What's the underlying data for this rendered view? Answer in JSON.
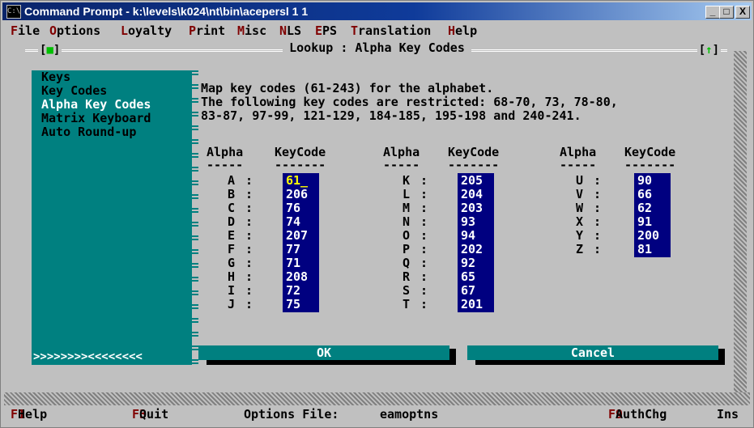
{
  "window": {
    "title": "Command Prompt - k:\\levels\\k024\\nt\\bin\\acepersl 1 1",
    "icon": "C:\\",
    "minimize": "_",
    "maximize": "□",
    "close": "X"
  },
  "menu": [
    {
      "hot": "F",
      "rest": "ile"
    },
    {
      "hot": "O",
      "rest": "ptions"
    },
    {
      "hot": "L",
      "rest": "oyalty"
    },
    {
      "hot": "P",
      "rest": "rint"
    },
    {
      "hot": "M",
      "rest": "isc"
    },
    {
      "hot": "N",
      "rest": "LS"
    },
    {
      "hot": "E",
      "rest": "PS"
    },
    {
      "hot": "T",
      "rest": "ranslation"
    },
    {
      "hot": "H",
      "rest": "elp"
    }
  ],
  "dialog": {
    "title": "Lookup : Alpha Key Codes",
    "close_box": "■",
    "zoom_box": "↑"
  },
  "sidebar": {
    "items": [
      "Keys",
      "Key Codes",
      "Alpha Key Codes",
      "Matrix Keyboard",
      "Auto Round-up"
    ],
    "active_index": 2,
    "scroller": ">>>>>>>><<<<<<<<"
  },
  "description": [
    "Map key codes (61-243) for the alphabet.",
    "The following key codes are restricted: 68-70, 73, 78-80,",
    "83-87, 97-99, 121-129, 184-185, 195-198 and 240-241."
  ],
  "table": {
    "alpha_header": "Alpha",
    "keycode_header": "KeyCode",
    "alpha_underline": "-----",
    "keycode_underline": "-------",
    "columns": [
      {
        "letters": [
          "A",
          "B",
          "C",
          "D",
          "E",
          "F",
          "G",
          "H",
          "I",
          "J"
        ],
        "codes": [
          "61",
          "206",
          "76",
          "74",
          "207",
          "77",
          "71",
          "208",
          "72",
          "75"
        ]
      },
      {
        "letters": [
          "K",
          "L",
          "M",
          "N",
          "O",
          "P",
          "Q",
          "R",
          "S",
          "T"
        ],
        "codes": [
          "205",
          "204",
          "203",
          "93",
          "94",
          "202",
          "92",
          "65",
          "67",
          "201"
        ]
      },
      {
        "letters": [
          "U",
          "V",
          "W",
          "X",
          "Y",
          "Z"
        ],
        "codes": [
          "90",
          "66",
          "62",
          "91",
          "200",
          "81"
        ]
      }
    ]
  },
  "buttons": {
    "ok": "OK",
    "cancel": "Cancel"
  },
  "statusbar": {
    "f1_key": "F1",
    "f1_label": "Help",
    "f3_key": "F3",
    "f3_label": "Quit",
    "options_file_label": "Options File:",
    "options_file_value": "eamoptns",
    "f9_key": "F9",
    "f9_label": "AuthChg",
    "ins": "Ins"
  },
  "colors": {
    "console_bg": "#c0c0c0",
    "teal": "#008080",
    "navy": "#000080",
    "hotkey": "#800000",
    "cursor": "#ffff00"
  }
}
